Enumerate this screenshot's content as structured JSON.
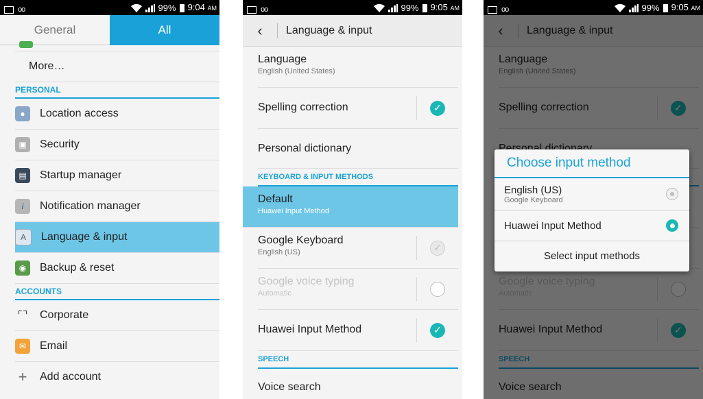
{
  "status": [
    {
      "time": "9:04",
      "ampm": "AM",
      "battery": "99%"
    },
    {
      "time": "9:05",
      "ampm": "AM",
      "battery": "99%"
    },
    {
      "time": "9:05",
      "ampm": "AM",
      "battery": "99%"
    }
  ],
  "panel1": {
    "tabs": [
      "General",
      "All"
    ],
    "rows": {
      "more": "More…",
      "location": "Location access",
      "security": "Security",
      "startup": "Startup manager",
      "notification": "Notification manager",
      "language": "Language & input",
      "backup": "Backup & reset",
      "corporate": "Corporate",
      "email": "Email",
      "add_account": "Add account"
    },
    "sections": {
      "personal": "PERSONAL",
      "accounts": "ACCOUNTS"
    }
  },
  "panel2": {
    "title": "Language & input",
    "language": {
      "title": "Language",
      "sub": "English (United States)"
    },
    "spelling": "Spelling correction",
    "dictionary": "Personal dictionary",
    "section_kb": "KEYBOARD & INPUT METHODS",
    "default": {
      "title": "Default",
      "sub": "Huawei Input Method"
    },
    "google_kb": {
      "title": "Google Keyboard",
      "sub": "English (US)"
    },
    "voice_typing": {
      "title": "Google voice typing",
      "sub": "Automatic"
    },
    "huawei": "Huawei Input Method",
    "section_speech": "SPEECH",
    "voice_search": "Voice search"
  },
  "dialog": {
    "title": "Choose input method",
    "options": [
      {
        "title": "English (US)",
        "sub": "Google Keyboard",
        "selected": false
      },
      {
        "title": "Huawei Input Method",
        "sub": "",
        "selected": true
      }
    ],
    "button": "Select input methods"
  },
  "colors": {
    "accent": "#1aa2d8",
    "check": "#1ab8b4",
    "highlight": "#6ec6e6"
  }
}
